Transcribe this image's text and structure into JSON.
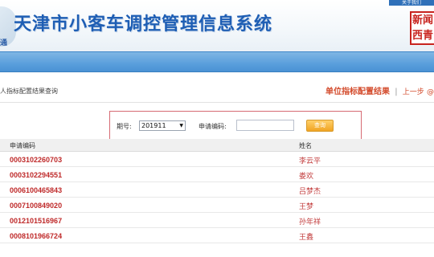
{
  "header": {
    "title": "天津市小客车调控管理信息系统",
    "logo_text": "通",
    "gov_link": "关于我们",
    "emblem_text": "新闻西青"
  },
  "subheader": {
    "left_title": "人指标配置结果查询",
    "right_title": "单位指标配置结果",
    "separator": "|",
    "back_link": "上一步",
    "extra": "@"
  },
  "search": {
    "period_label": "期号:",
    "period_value": "201911",
    "apply_label": "申请编码:",
    "apply_value": "",
    "query_button": "查询"
  },
  "table": {
    "headers": {
      "code": "申请编码",
      "name": "姓名"
    },
    "rows": [
      {
        "code": "0003102260703",
        "name": "李云平"
      },
      {
        "code": "0003102294551",
        "name": "娄欢"
      },
      {
        "code": "0006100465843",
        "name": "吕梦杰"
      },
      {
        "code": "0007100849020",
        "name": "王梦"
      },
      {
        "code": "0012101516967",
        "name": "孙年祥"
      },
      {
        "code": "0008101966724",
        "name": "王鑫"
      }
    ]
  }
}
